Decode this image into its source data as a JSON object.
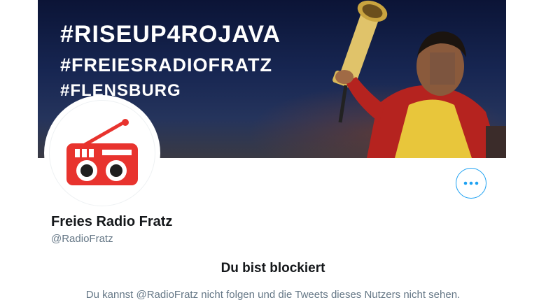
{
  "colors": {
    "accent": "#1da1f2",
    "radio_red": "#e8332e",
    "text_primary": "#14171a",
    "text_secondary": "#657786"
  },
  "banner": {
    "line1": "#RISEUP4ROJAVA",
    "line2": "#FREIESRADIOFRATZ",
    "line3": "#FLENSBURG"
  },
  "profile": {
    "avatar_icon": "radio-icon",
    "name": "Freies Radio Fratz",
    "handle": "@RadioFratz",
    "more_icon": "more-dots-icon"
  },
  "blocked": {
    "title": "Du bist blockiert",
    "description": "Du kannst @RadioFratz nicht folgen und die Tweets dieses Nutzers nicht sehen."
  }
}
